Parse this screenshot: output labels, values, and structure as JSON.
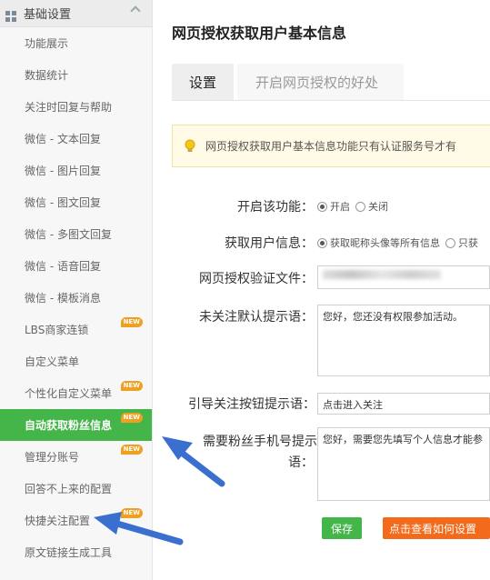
{
  "sidebar": {
    "header": {
      "label": "基础设置"
    },
    "items": [
      {
        "label": "功能展示",
        "badge": ""
      },
      {
        "label": "数据统计",
        "badge": ""
      },
      {
        "label": "关注时回复与帮助",
        "badge": ""
      },
      {
        "label": "微信 - 文本回复",
        "badge": ""
      },
      {
        "label": "微信 - 图片回复",
        "badge": ""
      },
      {
        "label": "微信 - 图文回复",
        "badge": ""
      },
      {
        "label": "微信 - 多图文回复",
        "badge": ""
      },
      {
        "label": "微信 - 语音回复",
        "badge": ""
      },
      {
        "label": "微信 - 模板消息",
        "badge": ""
      },
      {
        "label": "LBS商家连锁",
        "badge": "NEW"
      },
      {
        "label": "自定义菜单",
        "badge": ""
      },
      {
        "label": "个性化自定义菜单",
        "badge": "NEW"
      },
      {
        "label": "自动获取粉丝信息",
        "badge": "NEW",
        "active": true
      },
      {
        "label": "管理分账号",
        "badge": "NEW"
      },
      {
        "label": "回答不上来的配置",
        "badge": ""
      },
      {
        "label": "快捷关注配置",
        "badge": "NEW"
      },
      {
        "label": "原文链接生成工具",
        "badge": ""
      }
    ]
  },
  "main": {
    "title": "网页授权获取用户基本信息",
    "tabs": [
      {
        "label": "设置"
      },
      {
        "label": "开启网页授权的好处"
      }
    ],
    "notice": "网页授权获取用户基本信息功能只有认证服务号才有",
    "form": {
      "enable": {
        "label": "开启该功能：",
        "opt_on": "开启",
        "opt_off": "关闭"
      },
      "userinfo": {
        "label": "获取用户信息：",
        "opt_all": "获取昵称头像等所有信息",
        "opt_only": "只获"
      },
      "verify_file": {
        "label": "网页授权验证文件："
      },
      "unfollow_tip": {
        "label": "未关注默认提示语：",
        "value": "您好，您还没有权限参加活动。"
      },
      "guide_btn": {
        "label": "引导关注按钮提示语：",
        "value": "点击进入关注"
      },
      "phone_tip": {
        "label_line1": "需要粉丝手机号提示",
        "label_line2": "语：",
        "value": "您好，需要您先填写个人信息才能参"
      }
    },
    "buttons": {
      "save": "保存",
      "how": "点击查看如何设置"
    }
  },
  "colors": {
    "active_green": "#44b549",
    "badge_orange": "#f0a020",
    "how_button_orange": "#f46a1b",
    "arrow_blue": "#3a6fcf"
  }
}
